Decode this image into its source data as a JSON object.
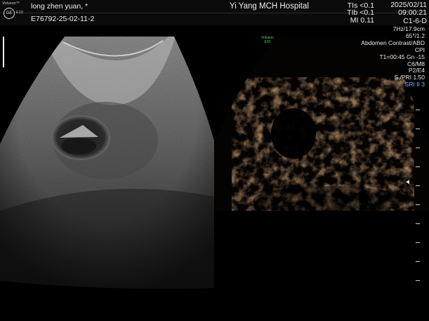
{
  "header": {
    "brand": "Voluson™",
    "logo_text": "GE",
    "model": "E10",
    "patient_name": "long  zhen  yuan,  *",
    "patient_id": "E76792-25-02-11-2",
    "hospital": "Yi Yang MCH Hospital",
    "tis": "TIs <0.1",
    "tib": "TIb <0.1",
    "mi": "MI  0.11",
    "date": "2025/02/11",
    "time": "09:00:21",
    "probe": "C1-6-D"
  },
  "scan_params": [
    "7Hz/17.9cm",
    "65°/1.2",
    "Abdomen Contrast/ABD",
    "CPI",
    "T1=00:45  Gn -15",
    "C6/M8",
    "P2/E4",
    "S./PRI 1.50",
    "SRI II 3"
  ],
  "mini_label": {
    "brand": "Voluson",
    "model": "E10"
  },
  "colors": {
    "background": "#000000",
    "accent_green": "#48e048",
    "sri_blue": "#7fb0ff",
    "contrast_tint": "#c8763a"
  },
  "icons": {
    "logo": "ge-logo-icon",
    "focus": "focus-marker-icon",
    "depth": "depth-scale-icon"
  }
}
